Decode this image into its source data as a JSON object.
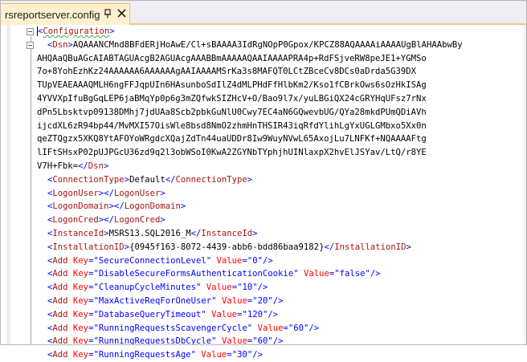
{
  "tab": {
    "title": "rsreportserver.config",
    "pin_icon": "pin-icon",
    "close_icon": "close-icon"
  },
  "xml": {
    "root_tag": "Configuration",
    "dsn_tag": "Dsn",
    "dsn_lines": [
      "AQAAANCMnd8BFdERjHoAwE/Cl+sBAAAA3IdRgNOpP0Gpox/KPCZ88AQAAAAiAAAAUgBlAHAAbwBy",
      "AHQAaQBuAGcAIABTAGUAcgB2AGUAcgAAABBmAAAAAQAAIAAAAPRA4p+RdFSjveRW8peJE1+YGMSo",
      "7o+8YohEzhKz24AAAAAA6AAAAAAgAAIAAAAMSrKa3s8MAFQT0LCtZBceCv8DCs0aDrda5G39DX",
      "TUpVEAEAAAQMLH6ngFFJqpUIn6HAsunboSdIlZ4dMLPHdFfHlbKm2/Kso1fCBrkOws6sOzHkISAg",
      "4YVVXpIfuBgGqLEP6jaBMqYp0p6g3mZQfwkSIZHcV+O/Bao9l7x/yuLBGiQX24cGRYHqUFsz7rNx",
      "dPn5Lbsktvp09138DMhj7jdUAa8Scb2pbkGuNlU0Cwy7EC4aN6GQwevbUG/QYa28mkdPUmQDiAVh",
      "ijcdXL6zR94bp44/MvMXI57OisWle8bsd8NmO2zhmHnTHSIR43iqRfdYlihLgYxUGLGMbxo5Xx0n",
      "qeZTQgzx5XKQ8YtAFOYoWRgdcXQajZdTn44uaUDDr8Iw9WuyNVwL65AxojLu7LNFKf+NQAAAAFtg",
      "lIFtSHsxP02pUJPGcU36zd9q2l3obWSoI0KwA2ZGYNbTYphjhUINlaxpX2hvElJSYav/LtQ/r8YE",
      "V7H+Fbk="
    ],
    "elements": [
      {
        "tag": "ConnectionType",
        "text": "Default"
      },
      {
        "tag": "LogonUser",
        "text": ""
      },
      {
        "tag": "LogonDomain",
        "text": ""
      },
      {
        "tag": "LogonCred",
        "text": ""
      },
      {
        "tag": "InstanceId",
        "text": "MSRS13.SQL2016_M"
      },
      {
        "tag": "InstallationID",
        "text": "{0945f163-8072-4439-abb6-bdd86baa9182}"
      }
    ],
    "add_tag": "Add",
    "key_attr": "Key",
    "value_attr": "Value",
    "adds": [
      {
        "key": "SecureConnectionLevel",
        "value": "0"
      },
      {
        "key": "DisableSecureFormsAuthenticationCookie",
        "value": "false"
      },
      {
        "key": "CleanupCycleMinutes",
        "value": "10"
      },
      {
        "key": "MaxActiveReqForOneUser",
        "value": "20"
      },
      {
        "key": "DatabaseQueryTimeout",
        "value": "120"
      },
      {
        "key": "RunningRequestsScavengerCycle",
        "value": "60"
      },
      {
        "key": "RunningRequestsDbCycle",
        "value": "60"
      },
      {
        "key": "RunningRequestsAge",
        "value": "30"
      }
    ]
  },
  "colors": {
    "tab_active": "#fff1d0",
    "xml_punct": "#0000ff",
    "xml_tag": "#a31515",
    "xml_attr": "#ff0000",
    "xml_value": "#0000ff"
  }
}
